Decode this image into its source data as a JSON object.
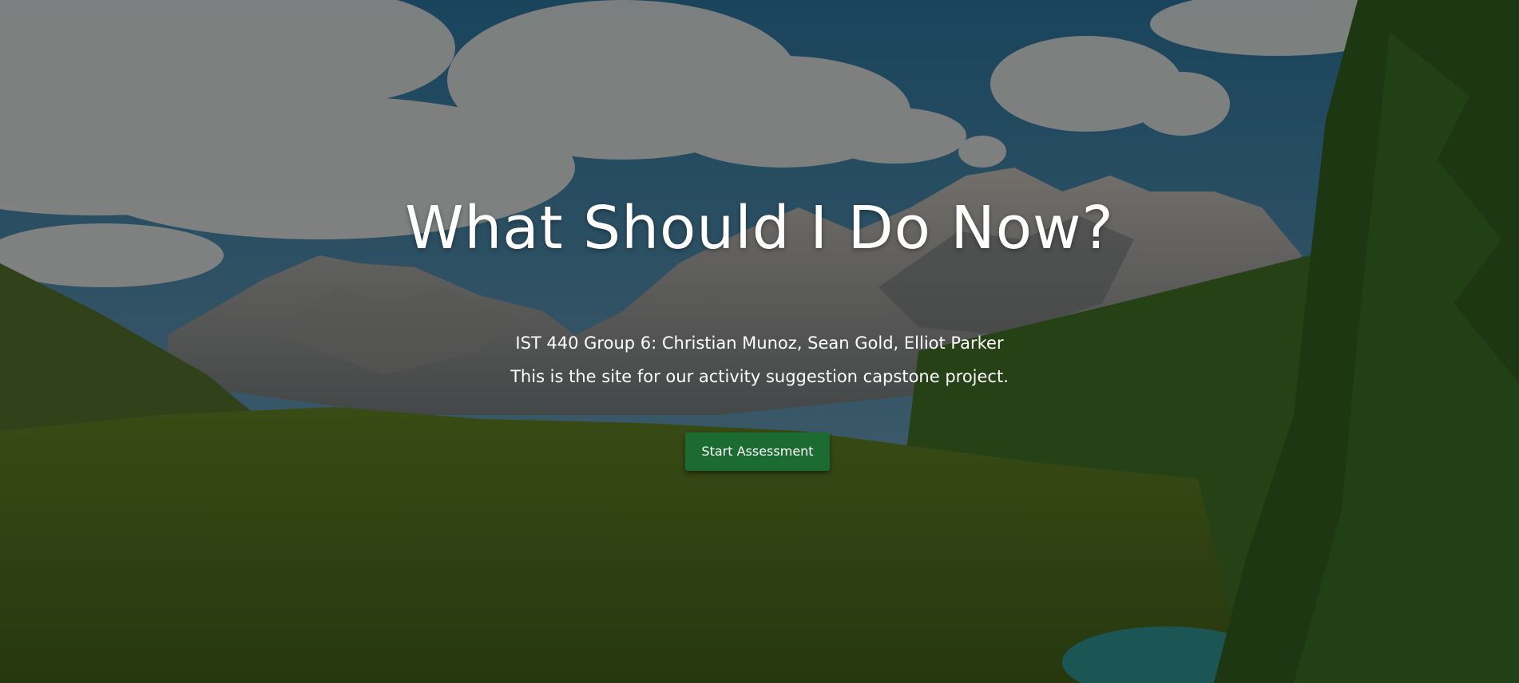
{
  "hero": {
    "title": "What Should I Do Now?",
    "credits": "IST 440 Group 6: Christian Munoz, Sean Gold, Elliot Parker",
    "tagline": "This is the site for our activity suggestion capstone project.",
    "cta_label": "Start Assessment"
  },
  "colors": {
    "cta_background": "#1b6b32",
    "text": "#ffffff",
    "overlay": "rgba(0,0,0,0.38)"
  }
}
